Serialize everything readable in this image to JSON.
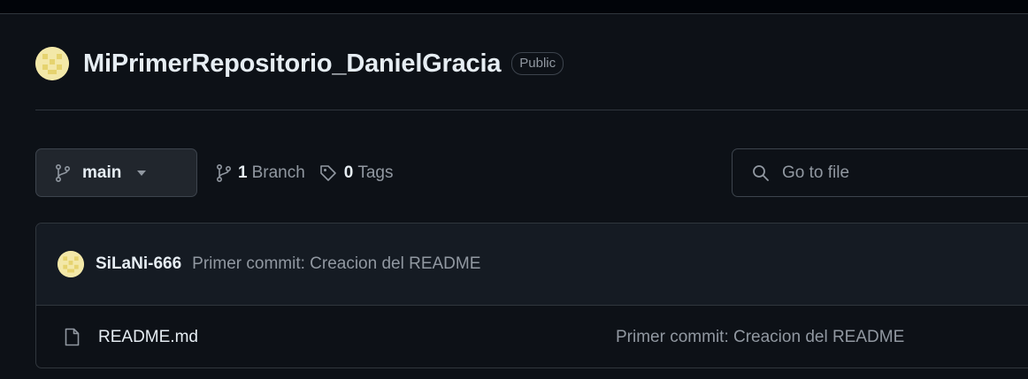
{
  "repo": {
    "name": "MiPrimerRepositorio_DanielGracia",
    "visibility": "Public"
  },
  "branch_selector": {
    "current": "main"
  },
  "branches": {
    "count": "1",
    "label": "Branch"
  },
  "tags": {
    "count": "0",
    "label": "Tags"
  },
  "search": {
    "placeholder": "Go to file"
  },
  "latest_commit": {
    "author": "SiLaNi-666",
    "message": "Primer commit: Creacion del README"
  },
  "files": [
    {
      "name": "README.md",
      "icon": "file-icon",
      "last_commit": "Primer commit: Creacion del README"
    }
  ],
  "colors": {
    "background": "#0d1117",
    "topbar": "#010409",
    "border": "#30363d",
    "button_bg": "#21262d",
    "text_primary": "#e6edf3",
    "text_muted": "#9198a1",
    "avatar": "#f2e6a6"
  }
}
